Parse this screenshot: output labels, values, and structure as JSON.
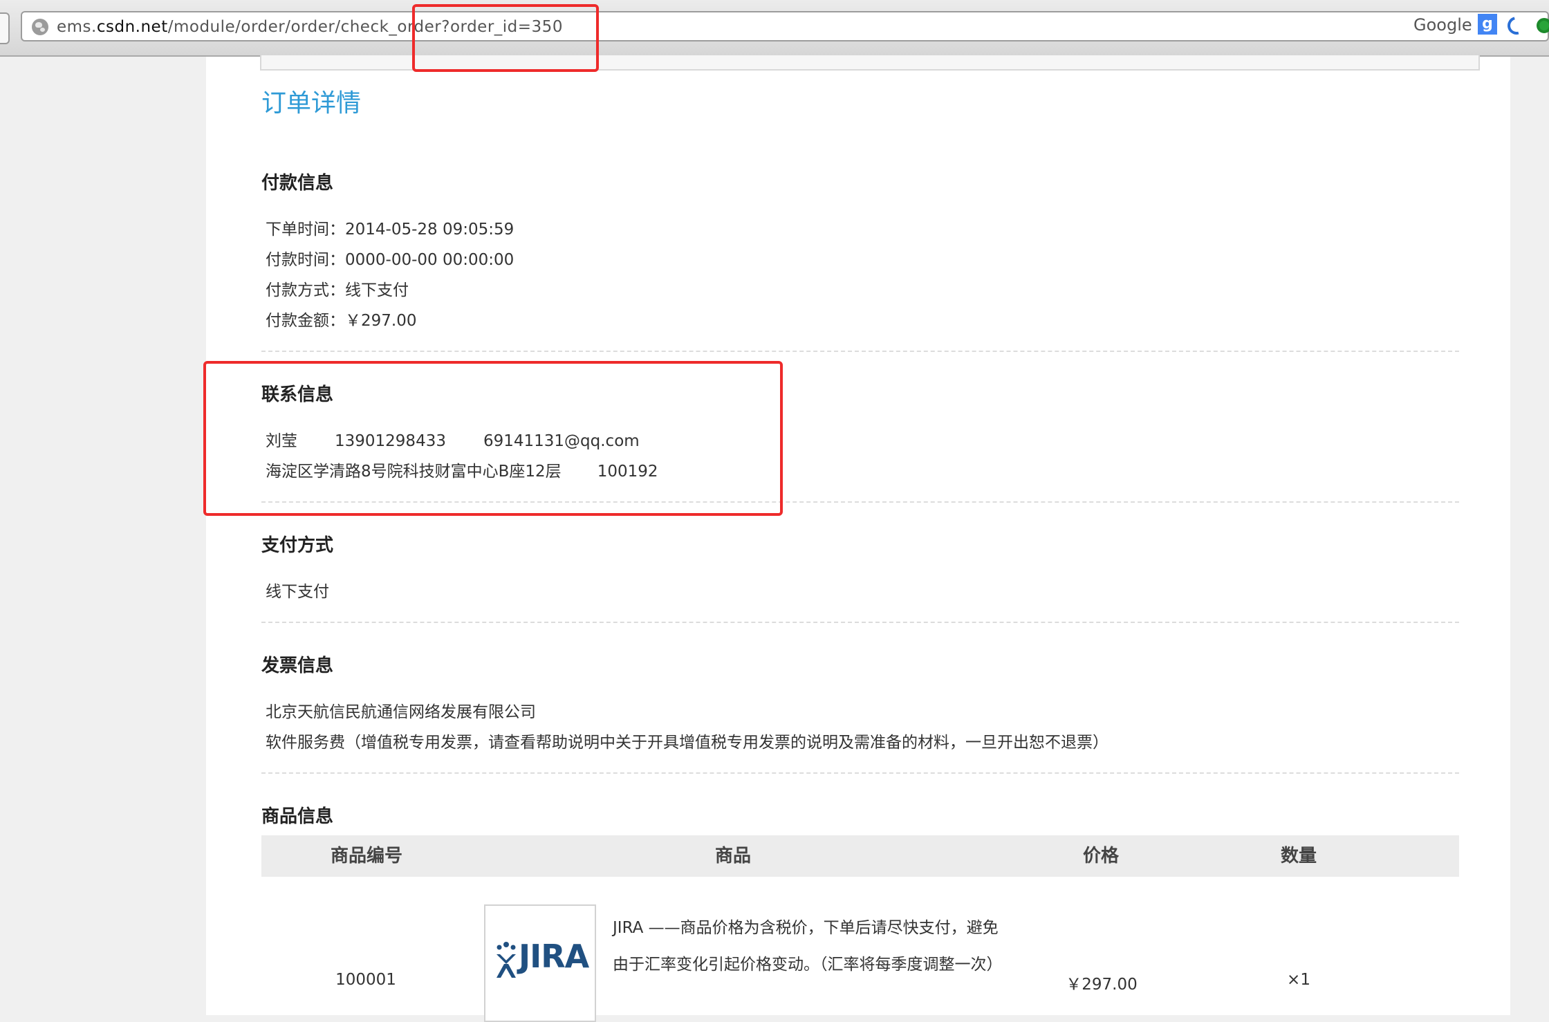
{
  "browser": {
    "url_prefix": "ems.",
    "url_domain": "csdn.net",
    "url_path": "/module/order/order/check_order?order_id=350",
    "search_engine": "Google"
  },
  "page": {
    "title": "订单详情",
    "payment_info": {
      "heading": "付款信息",
      "order_time": "下单时间：2014-05-28 09:05:59",
      "pay_time": "付款时间：0000-00-00 00:00:00",
      "pay_method": "付款方式：线下支付",
      "pay_amount": "付款金额：￥297.00"
    },
    "contact_info": {
      "heading": "联系信息",
      "name": "刘莹",
      "phone": "13901298433",
      "email": "69141131@qq.com",
      "address": "海淀区学清路8号院科技财富中心B座12层",
      "zip": "100192"
    },
    "payment_method": {
      "heading": "支付方式",
      "value": "线下支付"
    },
    "invoice_info": {
      "heading": "发票信息",
      "company": "北京天航信民航通信网络发展有限公司",
      "type": "软件服务费（增值税专用发票，请查看帮助说明中关于开具增值税专用发票的说明及需准备的材料，一旦开出恕不退票）"
    },
    "product_info": {
      "heading": "商品信息",
      "columns": [
        "商品编号",
        "商品",
        "价格",
        "数量"
      ],
      "rows": [
        {
          "id": "100001",
          "logo_text": "JIRA",
          "description": "JIRA ——商品价格为含税价，下单后请尽快支付，避免由于汇率变化引起价格变动。（汇率将每季度调整一次）",
          "price": "￥297.00",
          "quantity": "×1"
        }
      ]
    }
  },
  "colors": {
    "title_blue": "#2e9ad6",
    "annotation_red": "#ee2b2b",
    "jira_blue": "#205081"
  }
}
